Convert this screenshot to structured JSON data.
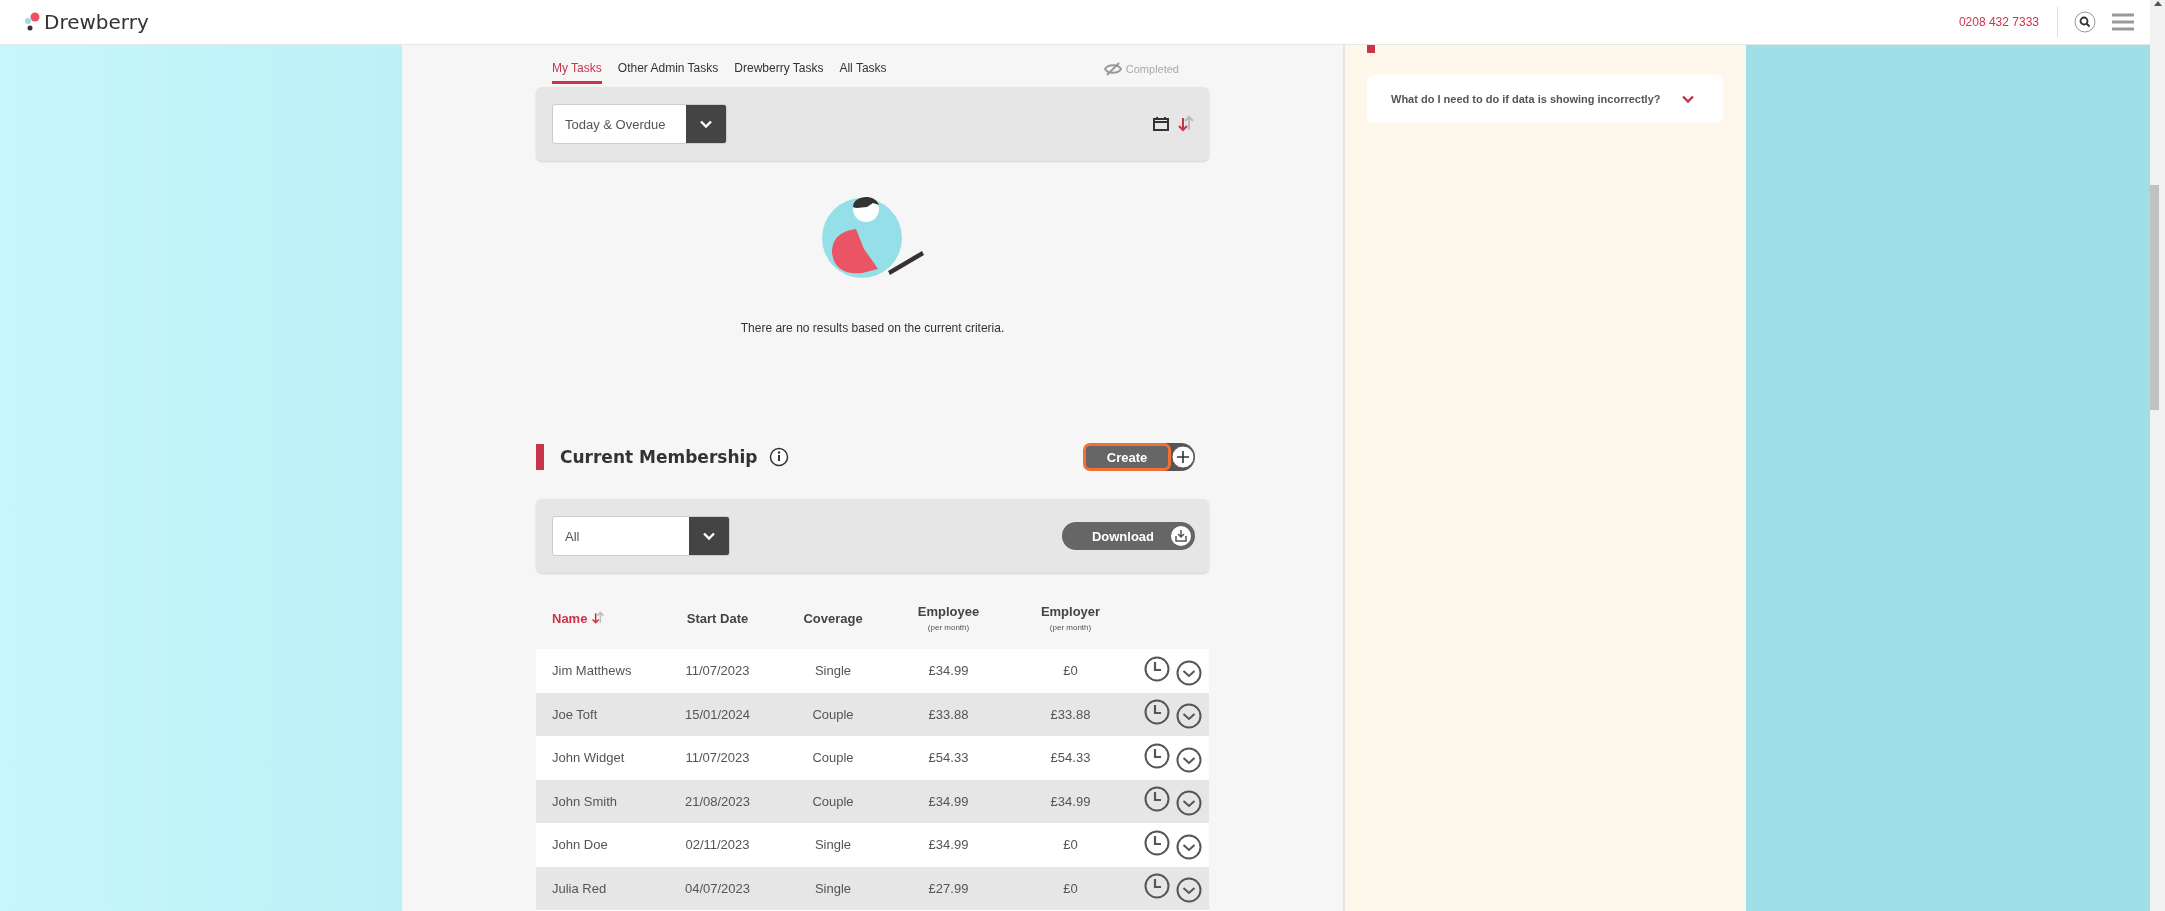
{
  "header": {
    "logo": "Drewberry",
    "phone": "0208 432 7333"
  },
  "tasks": {
    "tabs": [
      {
        "label": "My Tasks",
        "selected": true
      },
      {
        "label": "Other Admin Tasks",
        "selected": false
      },
      {
        "label": "Drewberry Tasks",
        "selected": false
      },
      {
        "label": "All Tasks",
        "selected": false
      }
    ],
    "completed_toggle": "Completed",
    "filter": {
      "value": "Today & Overdue"
    },
    "empty_message": "There are no results based on the current criteria."
  },
  "membership": {
    "title": "Current Membership",
    "create_button": "Create",
    "filter": {
      "value": "All"
    },
    "download_button": "Download",
    "table": {
      "columns": [
        {
          "label": "Name",
          "sorted": true
        },
        {
          "label": "Start Date",
          "sorted": false
        },
        {
          "label": "Coverage",
          "sorted": false
        },
        {
          "label": "Employee",
          "sublabel": "(per month)",
          "sorted": false
        },
        {
          "label": "Employer",
          "sublabel": "(per month)",
          "sorted": false
        }
      ],
      "rows": [
        [
          "Jim Matthews",
          "11/07/2023",
          "Single",
          "£34.99",
          "£0"
        ],
        [
          "Joe Toft",
          "15/01/2024",
          "Couple",
          "£33.88",
          "£33.88"
        ],
        [
          "John Widget",
          "11/07/2023",
          "Couple",
          "£54.33",
          "£54.33"
        ],
        [
          "John Smith",
          "21/08/2023",
          "Couple",
          "£34.99",
          "£34.99"
        ],
        [
          "John Doe",
          "02/11/2023",
          "Single",
          "£34.99",
          "£0"
        ],
        [
          "Julia Red",
          "04/07/2023",
          "Single",
          "£27.99",
          "£0"
        ]
      ]
    }
  },
  "faq": [
    {
      "question": "What do I need to do if data is showing incorrectly?",
      "expanded": false
    }
  ]
}
